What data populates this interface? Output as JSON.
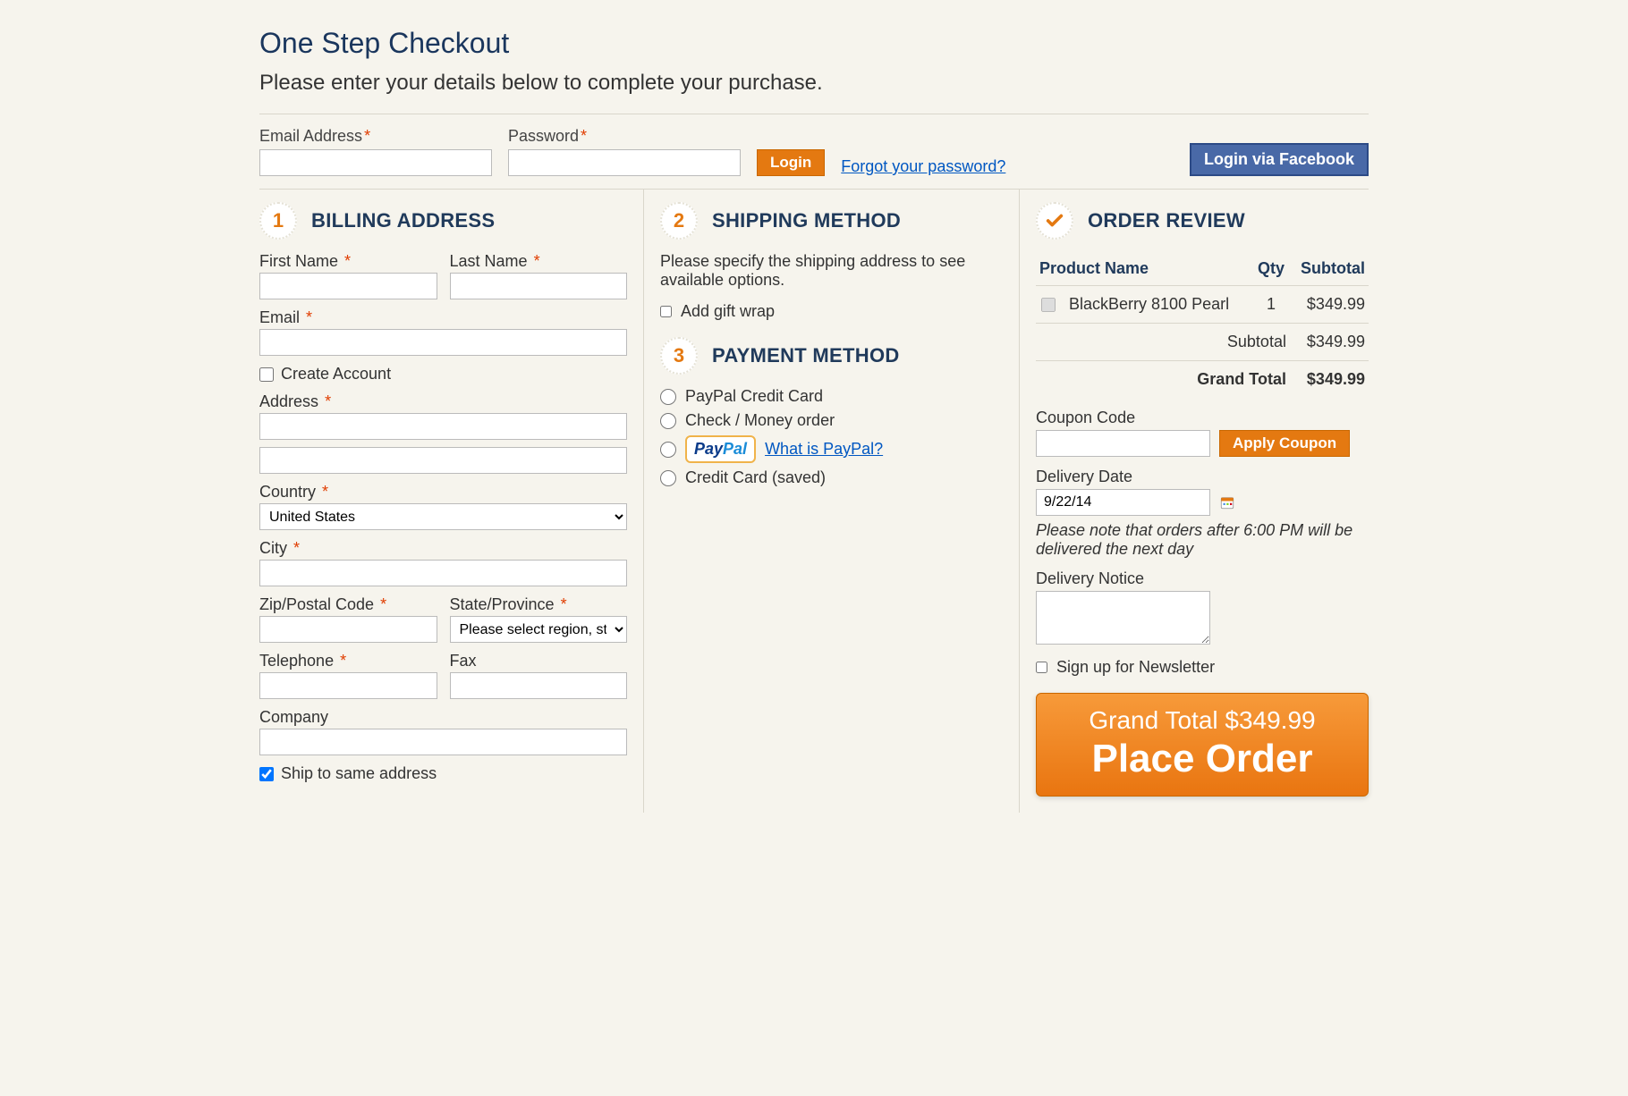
{
  "title": "One Step Checkout",
  "subtitle": "Please enter your details below to complete your purchase.",
  "login": {
    "email_label": "Email Address",
    "password_label": "Password",
    "login_btn": "Login",
    "forgot_link": "Forgot your password?",
    "fb_btn": "Login via Facebook"
  },
  "billing": {
    "title": "BILLING ADDRESS",
    "first_name": "First Name",
    "last_name": "Last Name",
    "email": "Email",
    "create_account": "Create Account",
    "address": "Address",
    "country": "Country",
    "country_value": "United States",
    "city": "City",
    "zip": "Zip/Postal Code",
    "state": "State/Province",
    "state_value": "Please select region, state or province",
    "telephone": "Telephone",
    "fax": "Fax",
    "company": "Company",
    "ship_same": "Ship to same address"
  },
  "shipping": {
    "title": "SHIPPING METHOD",
    "note": "Please specify the shipping address to see available options.",
    "gift_wrap": "Add gift wrap"
  },
  "payment": {
    "title": "PAYMENT METHOD",
    "options": [
      "PayPal Credit Card",
      "Check / Money order",
      "",
      "Credit Card (saved)"
    ],
    "paypal_brand1": "Pay",
    "paypal_brand2": "Pal",
    "what_is": "What is PayPal?"
  },
  "review": {
    "title": "ORDER REVIEW",
    "cols": {
      "name": "Product Name",
      "qty": "Qty",
      "subtotal": "Subtotal"
    },
    "items": [
      {
        "name": "BlackBerry 8100 Pearl",
        "qty": "1",
        "subtotal": "$349.99"
      }
    ],
    "subtotal_label": "Subtotal",
    "subtotal_value": "$349.99",
    "grand_label": "Grand Total",
    "grand_value": "$349.99",
    "coupon_label": "Coupon Code",
    "apply_coupon": "Apply Coupon",
    "delivery_date_label": "Delivery Date",
    "delivery_date_value": "9/22/14",
    "delivery_note": "Please note that orders after 6:00 PM will be delivered the next day",
    "delivery_notice_label": "Delivery Notice",
    "newsletter": "Sign up for Newsletter",
    "place_grand": "Grand Total $349.99",
    "place_label": "Place Order"
  }
}
